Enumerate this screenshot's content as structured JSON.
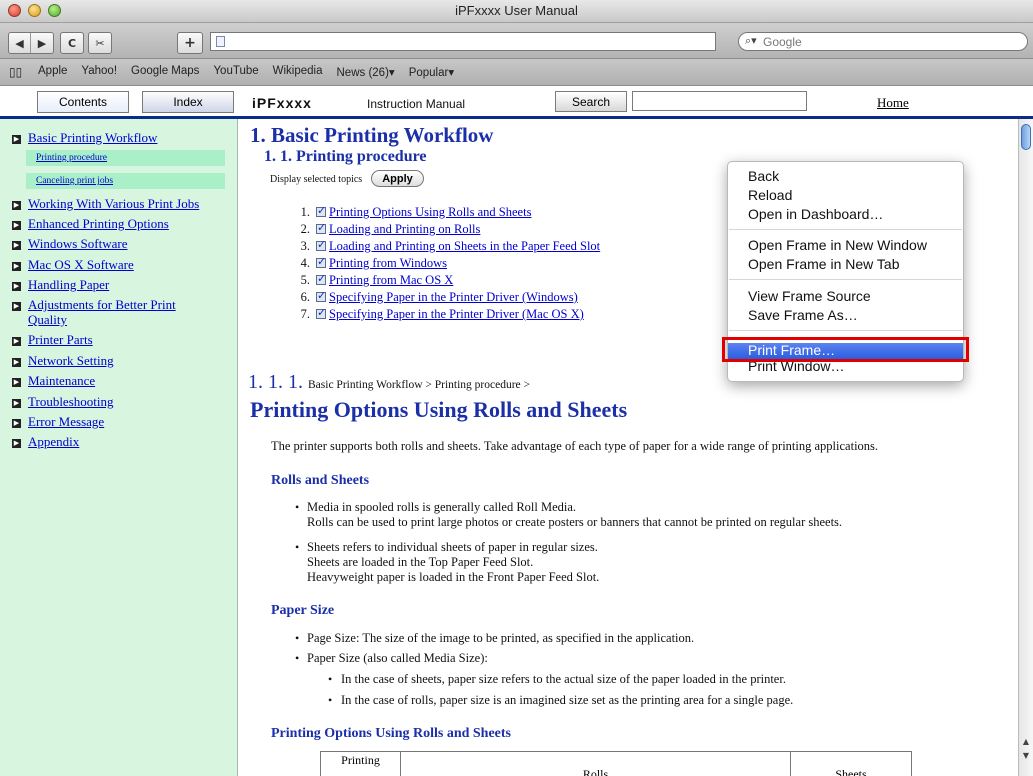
{
  "window": {
    "title": "iPFxxxx User Manual"
  },
  "toolbar": {
    "back_icon": "◀",
    "forward_icon": "▶",
    "reload_icon": "C",
    "snippet_icon": "✂",
    "add_icon": "+",
    "search_placeholder": "Google"
  },
  "bookmarks": [
    "Apple",
    "Yahoo!",
    "Google Maps",
    "YouTube",
    "Wikipedia",
    "News (26)▾",
    "Popular▾"
  ],
  "header": {
    "tab_contents": "Contents",
    "tab_index": "Index",
    "brand": "iPFxxxx",
    "brand_sub": "Instruction Manual",
    "search_button": "Search",
    "home": "Home"
  },
  "nav": {
    "items": [
      "Basic Printing Workflow",
      "Working With Various Print Jobs",
      "Enhanced Printing Options",
      "Windows Software",
      "Mac OS X Software",
      "Handling Paper",
      "Adjustments for Better Print",
      "Quality",
      "Printer Parts",
      "Network Setting",
      "Maintenance",
      "Troubleshooting",
      "Error Message",
      "Appendix"
    ],
    "sub_items": [
      "Printing procedure",
      "Canceling print jobs"
    ]
  },
  "main": {
    "h1": "1. Basic Printing Workflow",
    "h2": "1. 1. Printing procedure",
    "display_topics": "Display selected topics",
    "apply": "Apply",
    "topics": [
      {
        "num": "1.",
        "label": "Printing Options Using Rolls and Sheets"
      },
      {
        "num": "2.",
        "label": "Loading and Printing on Rolls"
      },
      {
        "num": "3.",
        "label": "Loading and Printing on Sheets in the Paper Feed Slot"
      },
      {
        "num": "4.",
        "label": "Printing from Windows"
      },
      {
        "num": "5.",
        "label": "Printing from Mac OS X"
      },
      {
        "num": "6.",
        "label": "Specifying Paper in the Printer Driver (Windows)"
      },
      {
        "num": "7.",
        "label": "Specifying Paper in the Printer Driver (Mac OS X)"
      }
    ],
    "section_num": "1. 1. 1.",
    "breadcrumbs": "Basic Printing Workflow > Printing procedure >",
    "section_title": "Printing Options Using Rolls and Sheets",
    "intro": "The printer supports both rolls and sheets. Take advantage of each type of paper for a wide range of printing applications.",
    "rolls_heading": "Rolls and Sheets",
    "rolls_p1a": "Media in spooled rolls is generally called Roll Media.",
    "rolls_p1b": "Rolls can be used to print large photos or create posters or banners that cannot be printed on regular sheets.",
    "rolls_p2a": "Sheets refers to individual sheets of paper in regular sizes.",
    "rolls_p2b": "Sheets are loaded in the Top Paper Feed Slot.",
    "rolls_p2c": "Heavyweight paper is loaded in the Front Paper Feed Slot.",
    "paper_heading": "Paper Size",
    "paper_b1": "Page Size: The size of the image to be printed, as specified in the application.",
    "paper_b2": "Paper Size (also called Media Size):",
    "paper_b2a": "In the case of sheets, paper size refers to the actual size of the paper loaded in the printer.",
    "paper_b2b": "In the case of rolls, paper size is an imagined size set as the printing area for a single page.",
    "options_heading": "Printing Options Using Rolls and Sheets",
    "table_headers": [
      "Printing",
      "Rolls",
      "Sheets"
    ]
  },
  "context_menu": {
    "items": [
      "Back",
      "Reload",
      "Open in Dashboard…",
      "Open Frame in New Window",
      "Open Frame in New Tab",
      "View Frame Source",
      "Save Frame As…",
      "Print Frame…",
      "Print Window…"
    ],
    "highlighted": "Print Frame…"
  }
}
